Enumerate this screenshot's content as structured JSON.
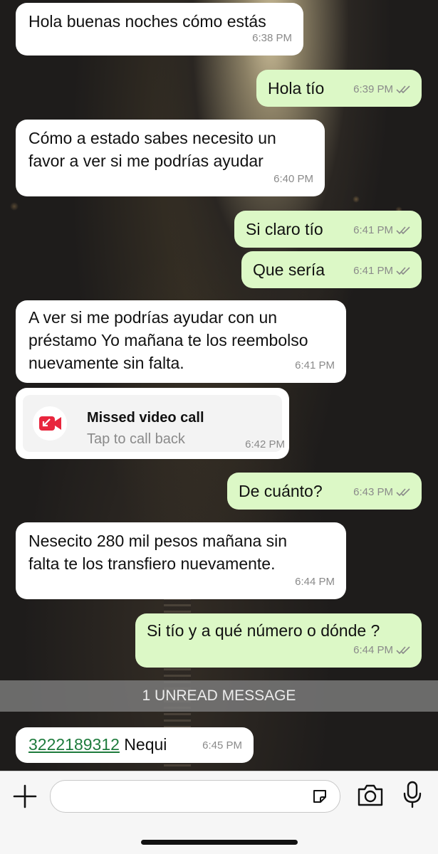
{
  "messages": [
    {
      "text": "Hola buenas noches cómo estás",
      "time": "6:38 PM",
      "dir": "in"
    },
    {
      "text": "Hola tío",
      "time": "6:39 PM",
      "dir": "out"
    },
    {
      "text": "Cómo a estado sabes necesito un\nfavor a ver si me podrías ayudar",
      "time": "6:40 PM",
      "dir": "in"
    },
    {
      "text": "Si claro tío",
      "time": "6:41 PM",
      "dir": "out"
    },
    {
      "text": "Que sería",
      "time": "6:41 PM",
      "dir": "out"
    },
    {
      "text": "A ver si me podrías ayudar con un\npréstamo Yo mañana te los reembolso\nnuevamente sin falta.",
      "time": "6:41 PM",
      "dir": "in"
    },
    {
      "text": "De cuánto?",
      "time": "6:43 PM",
      "dir": "out"
    },
    {
      "text": "Nesecito 280 mil pesos mañana sin\nfalta te los transfiero nuevamente.",
      "time": "6:44 PM",
      "dir": "in"
    },
    {
      "text": "Si tío y a qué número o dónde ?",
      "time": "6:44 PM",
      "dir": "out"
    }
  ],
  "missed_call": {
    "title": "Missed video call",
    "subtitle": "Tap to call back",
    "time": "6:42 PM",
    "icon": "missed-video-call-icon",
    "icon_color": "#e8263d"
  },
  "unread_divider": "1 UNREAD MESSAGE",
  "last_message": {
    "link": "3222189312",
    "text": " Nequi",
    "time": "6:45 PM"
  },
  "compose": {
    "placeholder": "",
    "icons": [
      "plus-icon",
      "sticker-icon",
      "camera-icon",
      "microphone-icon"
    ]
  },
  "colors": {
    "outgoing_bubble": "#dcf8c6",
    "incoming_bubble": "#ffffff",
    "tick": "#8a8a8a"
  }
}
